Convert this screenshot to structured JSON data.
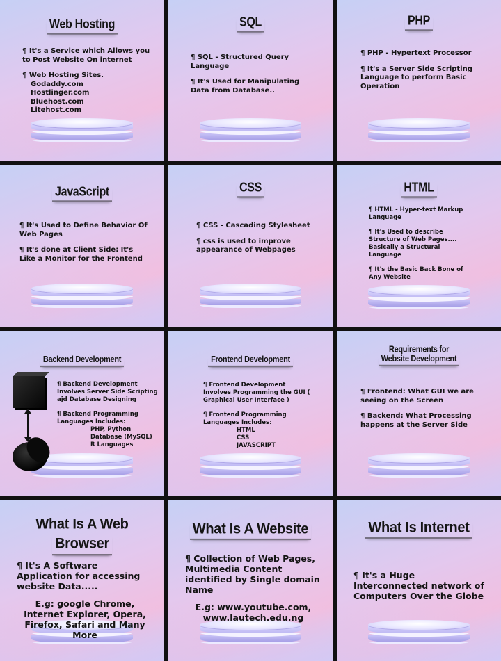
{
  "tiles": {
    "web_hosting": {
      "title": "Web Hosting",
      "line1": "¶ It's a Service which Allows you to Post Website On internet",
      "line2": "¶ Web Hosting Sites.",
      "sites": [
        "Godaddy.com",
        "Hostlinger.com",
        "Bluehost.com",
        "Litehost.com"
      ]
    },
    "sql": {
      "title": "SQL",
      "line1": "¶ SQL - Structured Query Language",
      "line2": "¶ It's Used for Manipulating Data from Database.."
    },
    "php": {
      "title": "PHP",
      "line1": "¶ PHP - Hypertext Processor",
      "line2": "¶ It's a Server Side Scripting Language to perform Basic Operation"
    },
    "javascript": {
      "title": "JavaScript",
      "line1": "¶ It's Used to Define Behavior Of Web Pages",
      "line2": "¶ It's done at Client Side: It's Like a Monitor for the Frontend"
    },
    "css": {
      "title": "CSS",
      "line1": "¶ CSS - Cascading Stylesheet",
      "line2": "¶ css is used to improve appearance of Webpages"
    },
    "html": {
      "title": "HTML",
      "line1": "¶ HTML - Hyper-text Markup Language",
      "line2": "¶ It's Used to describe Structure of Web Pages.... Basically a Structural Language",
      "line3": "¶ It's the Basic Back Bone of Any Website"
    },
    "backend": {
      "title": "Backend Development",
      "line1": "¶ Backend Development Involves Server Side Scripting ajd Database Designing",
      "line2": "¶ Backend Programming Languages Includes:",
      "langs": [
        "PHP, Python",
        "Database (MySQL)",
        "R Languages"
      ]
    },
    "frontend": {
      "title": "Frontend Development",
      "line1": "¶ Frontend Development Involves Programming the GUI ( Graphical User Interface )",
      "line2": "¶ Frontend Programming Languages Includes:",
      "langs": [
        "HTML",
        "CSS",
        "JAVASCRIPT"
      ]
    },
    "requirements": {
      "title_line1": "Requirements for",
      "title_line2": "Website Development",
      "line1": "¶ Frontend: What GUI we are seeing on the Screen",
      "line2": "¶ Backend: What Processing happens at the Server Side"
    },
    "browser": {
      "title_line1": "What Is A Web",
      "title_line2": "Browser",
      "line1": "¶ It's A Software Application for accessing website Data.....",
      "line2": "E.g: google Chrome, Internet Explorer, Opera, Firefox, Safari and Many More"
    },
    "website": {
      "title": "What Is A Website",
      "line1": "¶ Collection of Web Pages, Multimedia Content identified by Single domain Name",
      "line2": "E.g: www.youtube.com, www.lautech.edu.ng"
    },
    "internet": {
      "title": "What Is Internet",
      "line1": "¶ It's a Huge Interconnected network of Computers Over the Globe"
    }
  },
  "icons": [
    "server-cube-icon",
    "two-way-arrow-icon",
    "database-cylinder-icon"
  ]
}
